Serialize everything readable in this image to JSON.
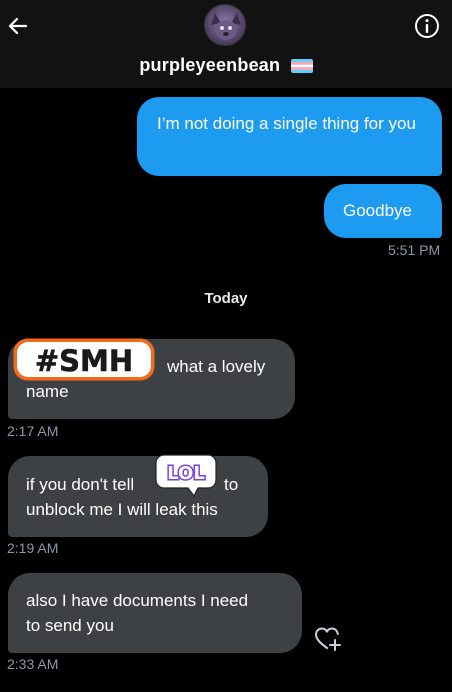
{
  "header": {
    "username": "purpleyeenbean",
    "back_icon": "arrow-left-icon",
    "info_icon": "info-circle-icon",
    "flag_icon": "transgender-flag-icon"
  },
  "conversation": {
    "sent": [
      {
        "text": "I’m not doing a single thing for you"
      },
      {
        "text": "Goodbye"
      }
    ],
    "sent_time": "5:51 PM",
    "day_separator": "Today",
    "received": [
      {
        "line1": "what a lovely",
        "line2": "name",
        "time": "2:17 AM",
        "sticker": "#SMH"
      },
      {
        "line1a": "if you don't tell",
        "line1b": "to",
        "line2": "unblock me I will leak this",
        "time": "2:19 AM",
        "sticker": "LOL"
      },
      {
        "line1": "also I have documents I need",
        "line2": "to send you",
        "time": "2:33 AM"
      }
    ],
    "react_icon": "heart-plus-icon"
  },
  "colors": {
    "sent_bubble": "#1d9bf0",
    "received_bubble": "#3e4144",
    "background": "#000000",
    "header_bg": "#121212",
    "timestamp": "#8b98a5",
    "sticker_orange": "#f26b1d",
    "sticker_purple": "#7b3fe4"
  }
}
